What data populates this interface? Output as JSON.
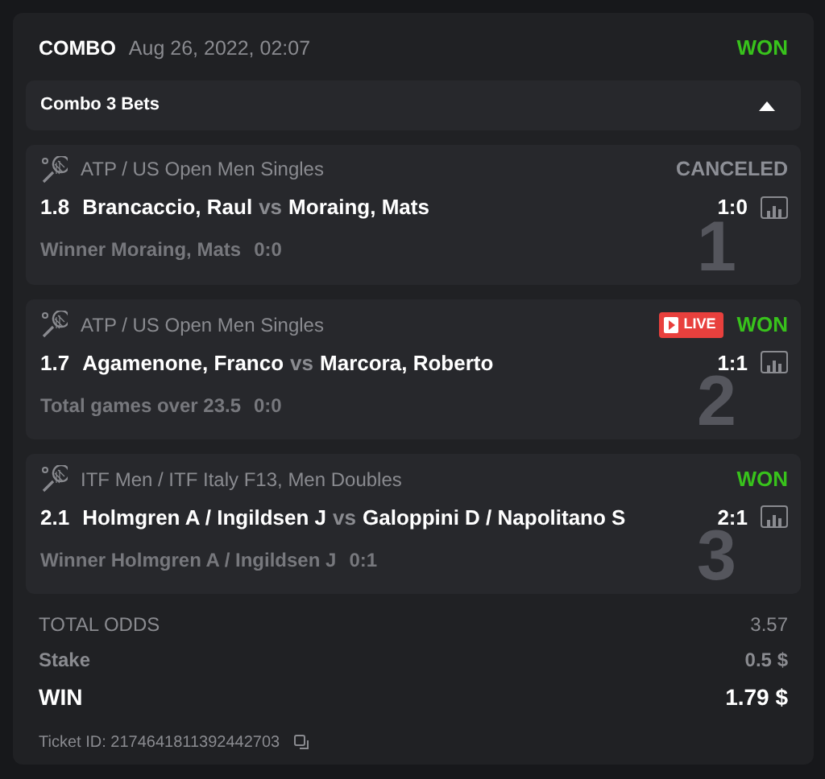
{
  "ticket": {
    "type": "COMBO",
    "date": "Aug 26, 2022, 02:07",
    "status": "WON"
  },
  "group": {
    "title": "Combo 3 Bets",
    "expanded": true
  },
  "bets": [
    {
      "league": "ATP / US Open Men Singles",
      "status": "CANCELED",
      "greyed": true,
      "odds": "1.8",
      "team1": "Brancaccio, Raul",
      "vs": "vs",
      "team2": "Moraing, Mats",
      "score": "1:0",
      "market": "Winner Moraing, Mats",
      "market_score": "0:0",
      "number": "1"
    },
    {
      "league": "ATP / US Open Men Singles",
      "live": true,
      "live_label": "LIVE",
      "status": "WON",
      "greyed": false,
      "odds": "1.7",
      "team1": "Agamenone, Franco",
      "vs": "vs",
      "team2": "Marcora, Roberto",
      "score": "1:1",
      "market": "Total games over 23.5",
      "market_score": "0:0",
      "number": "2"
    },
    {
      "league": "ITF Men / ITF Italy F13, Men Doubles",
      "status": "WON",
      "greyed": false,
      "odds": "2.1",
      "team1": "Holmgren A / Ingildsen J",
      "vs": "vs",
      "team2": "Galoppini D / Napolitano S",
      "score": "2:1",
      "market": "Winner Holmgren A / Ingildsen J",
      "market_score": "0:1",
      "number": "3"
    }
  ],
  "totals": [
    {
      "label": "TOTAL ODDS",
      "value": "3.57",
      "kind": "odds"
    },
    {
      "label": "Stake",
      "value": "0.5 $",
      "kind": "stake"
    },
    {
      "label": "WIN",
      "value": "1.79 $",
      "kind": "win"
    }
  ],
  "ticket_id": "Ticket ID: 2174641811392442703"
}
